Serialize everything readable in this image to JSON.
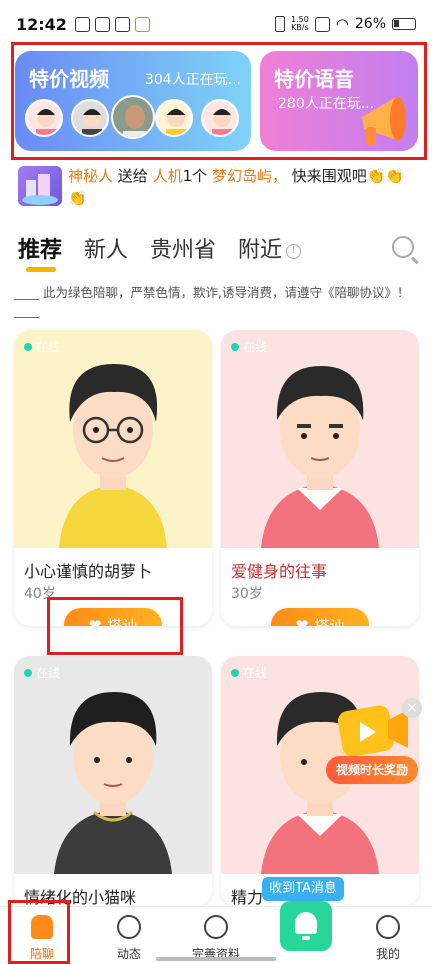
{
  "status": {
    "time": "12:42",
    "net_speed_value": "1.50",
    "net_speed_unit": "KB/s",
    "battery": "26%"
  },
  "banners": {
    "video": {
      "title": "特价视频",
      "online": "304人正在玩..."
    },
    "voice": {
      "title": "特价语音",
      "online": "280人正在玩..."
    }
  },
  "notice": {
    "sender": "神秘人",
    "verb": "送给",
    "receiver": "人机",
    "count": "1个",
    "gift": "梦幻岛屿，",
    "tail": "快来围观吧👏👏👏"
  },
  "tabs": [
    {
      "label": "推荐"
    },
    {
      "label": "新人"
    },
    {
      "label": "贵州省"
    },
    {
      "label": "附近"
    }
  ],
  "rule_text": "____ 此为绿色陪聊，严禁色情，欺诈,诱导消费，请遵守《陪聊协议》！ ____",
  "cards": [
    {
      "status": "在线",
      "name": "小心谨慎的胡萝卜",
      "age": "40岁",
      "button": "搭讪",
      "name_color": "#222222"
    },
    {
      "status": "在线",
      "name": "爱健身的往事",
      "age": "30岁",
      "button": "搭讪",
      "name_color": "#d03030"
    },
    {
      "status": "在线",
      "name": "情绪化的小猫咪",
      "age": "",
      "button": "",
      "name_color": "#222222"
    },
    {
      "status": "在线",
      "name": "精力",
      "age": "",
      "button": "",
      "name_color": "#222222"
    }
  ],
  "float_reward": {
    "label": "视频时长奖励"
  },
  "received_tip": "收到TA消息",
  "nav": [
    {
      "label": "陪聊",
      "icon": "home-icon"
    },
    {
      "label": "动态",
      "icon": "compass-icon"
    },
    {
      "label": "完善资料",
      "icon": "profile-icon"
    },
    {
      "label": "",
      "icon": "bell-icon"
    },
    {
      "label": "我的",
      "icon": "smile-icon"
    }
  ],
  "colors": {
    "accent": "#ff8c1a",
    "highlight_box": "#e02020",
    "online_dot": "#22d6b0",
    "bell_button": "#28d69a"
  }
}
